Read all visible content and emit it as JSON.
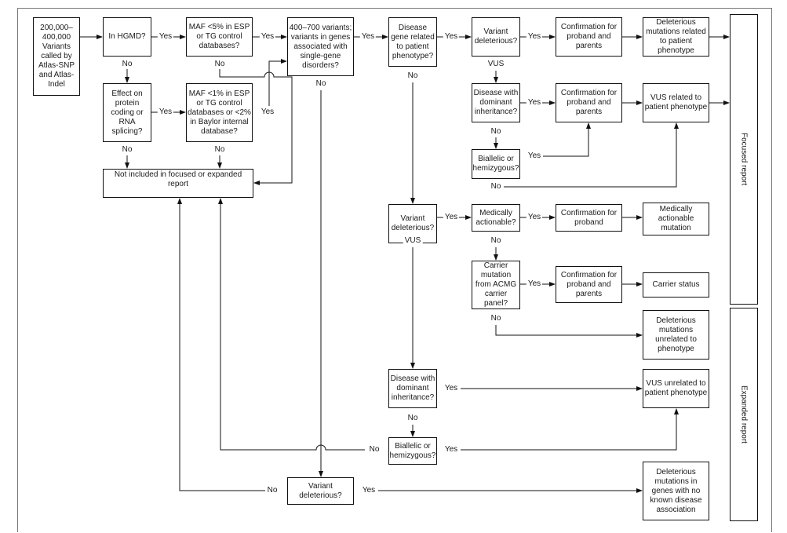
{
  "boxes": {
    "input": "200,000–400,000 Variants called by Atlas-SNP and Atlas-Indel",
    "hgmd": "In HGMD?",
    "maf5": "MAF <5% in ESP or TG control databases?",
    "variants400": "400–700 variants; variants in genes associated with single-gene disorders?",
    "disease_gene": "Disease gene related to patient phenotype?",
    "variant_del_1": "Variant deleterious?",
    "confirm_1": "Confirmation for proband and parents",
    "del_related": "Deleterious mutations related to patient phenotype",
    "effect": "Effect on protein coding or RNA splicing?",
    "maf1": "MAF <1% in ESP or TG control databases or <2% in Baylor internal database?",
    "not_included": "Not included in focused or expanded report",
    "dominant_1": "Disease with dominant inheritance?",
    "confirm_2": "Confirmation for proband and parents",
    "vus_related": "VUS related to patient phenotype",
    "biallelic_1": "Biallelic or hemizygous?",
    "variant_del_2": "Variant deleterious?",
    "med_actionable": "Medically actionable?",
    "confirm_3": "Confirmation for proband",
    "med_mutation": "Medically actionable mutation",
    "carrier": "Carrier mutation from ACMG carrier panel?",
    "confirm_4": "Confirmation for proband and parents",
    "carrier_status": "Carrier status",
    "del_unrelated": "Deleterious mutations unrelated to phenotype",
    "dominant_2": "Disease with dominant inheritance?",
    "vus_unrelated": "VUS unrelated to patient phenotype",
    "biallelic_2": "Biallelic or hemizygous?",
    "variant_del_3": "Variant deleterious?",
    "del_no_disease": "Deleterious mutations in genes with no known disease association"
  },
  "reports": {
    "focused": "Focused report",
    "expanded": "Expanded report"
  },
  "edge_labels": {
    "yes": "Yes",
    "no": "No",
    "vus": "VUS"
  }
}
